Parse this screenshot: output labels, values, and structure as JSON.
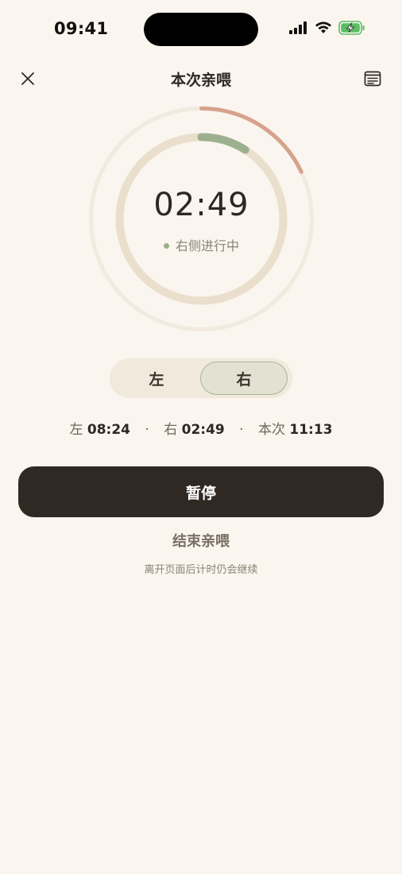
{
  "status_bar": {
    "time": "09:41",
    "icons": [
      "signal-icon",
      "wifi-icon",
      "battery-charging-icon"
    ]
  },
  "header": {
    "title": "本次亲喂",
    "close_icon": "close-icon",
    "log_icon": "list-doc-icon"
  },
  "timer": {
    "elapsed": "02:49",
    "status": "右侧进行中",
    "outer_progress": 0.18,
    "inner_progress": 0.09,
    "colors": {
      "outer_track": "#F2EADF",
      "outer_arc": "#D6A28C",
      "inner_track": "#E9DFCC",
      "inner_arc": "#9CB08F"
    }
  },
  "side_toggle": {
    "left_label": "左",
    "right_label": "右",
    "selected": "右"
  },
  "totals": {
    "left_label": "左",
    "left_value": "08:24",
    "separator": "·",
    "right_label": "右",
    "right_value": "02:49",
    "session_label": "本次",
    "session_value": "11:13"
  },
  "actions": {
    "pause_label": "暂停",
    "end_label": "结束亲喂",
    "hint": "离开页面后计时仍会继续"
  },
  "colors": {
    "background": "#FAF5EE",
    "primary_button": "#302823"
  }
}
